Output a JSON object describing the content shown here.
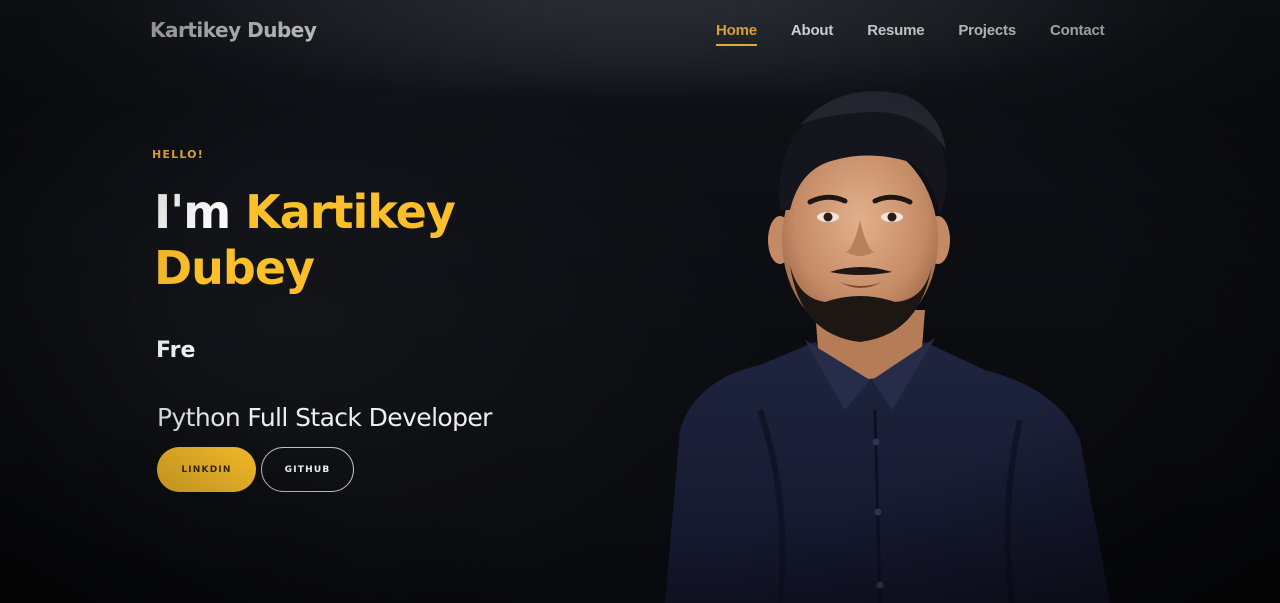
{
  "header": {
    "logo": "Kartikey Dubey",
    "nav": [
      {
        "label": "Home",
        "active": true
      },
      {
        "label": "About",
        "active": false
      },
      {
        "label": "Resume",
        "active": false
      },
      {
        "label": "Projects",
        "active": false
      },
      {
        "label": "Contact",
        "active": false
      }
    ]
  },
  "hero": {
    "greeting": "HELLO!",
    "intro": "I'm",
    "name_first": "Kartikey",
    "name_last": "Dubey",
    "typed_text": "Fre",
    "role": "Python Full Stack Developer",
    "buttons": {
      "linkedin": "LINKDIN",
      "github": "GITHUB"
    }
  },
  "colors": {
    "accent": "#fbbf2a",
    "background": "#0d0f13",
    "text": "#f2f2f2"
  },
  "icons": {
    "portrait": "profile-photo"
  }
}
